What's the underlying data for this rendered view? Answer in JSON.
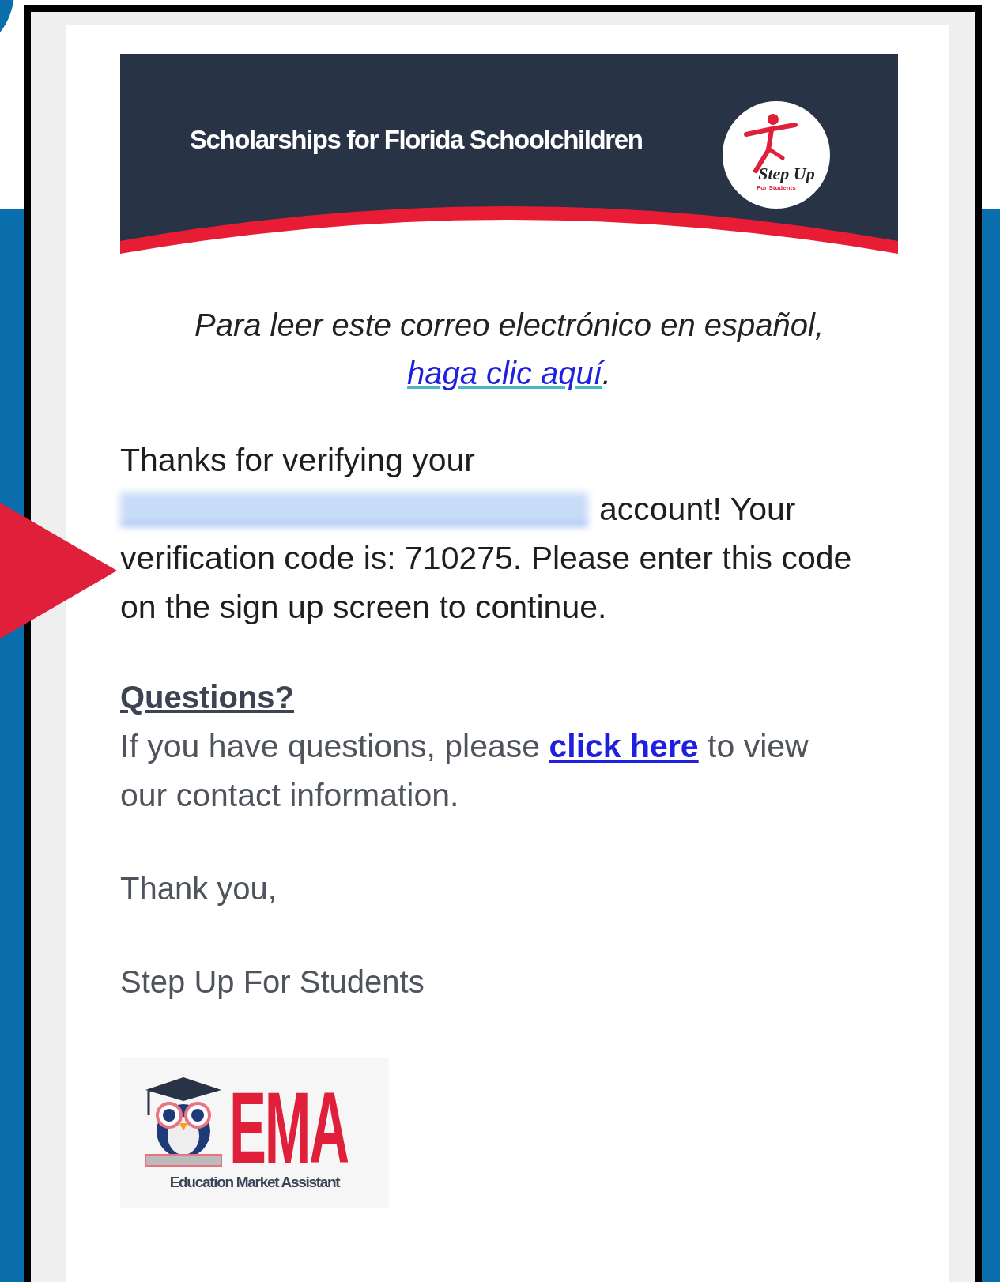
{
  "banner": {
    "title": "Scholarships for Florida Schoolchildren",
    "logo_script": "Step Up",
    "logo_sub": "For Students"
  },
  "spanish_notice": {
    "text": "Para leer este correo electrónico en español, ",
    "link": "haga clic aquí",
    "after": "."
  },
  "message": {
    "before": "Thanks for verifying your",
    "after_line": "account! Your",
    "rest": "verification code is: 710275. Please enter this code on the sign up screen to continue."
  },
  "questions": {
    "heading": "Questions?",
    "before": "If you have questions, please ",
    "link": "click here",
    "after": " to view our contact information."
  },
  "closing": "Thank you,",
  "signature": "Step Up For Students",
  "footer_logo": {
    "letters": "EMA",
    "tagline": "Education Market Assistant"
  }
}
